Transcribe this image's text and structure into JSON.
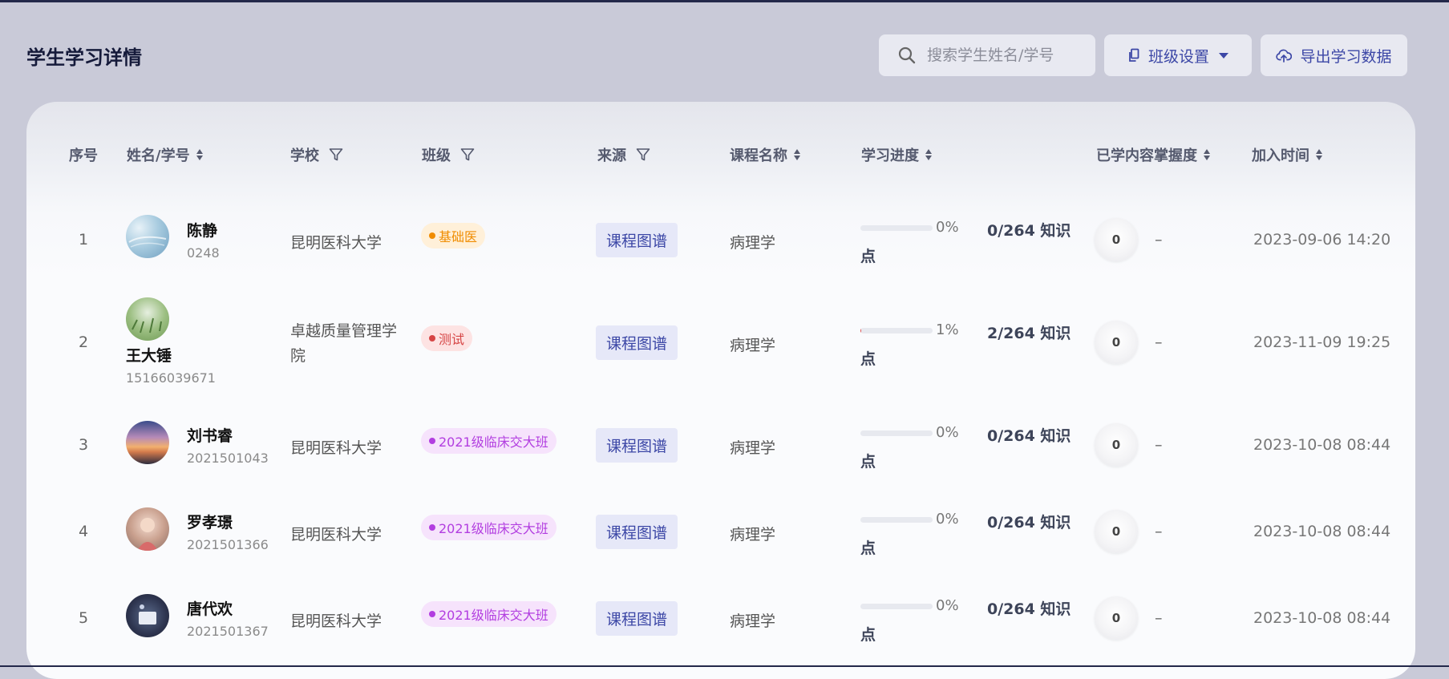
{
  "page": {
    "title": "学生学习详情"
  },
  "toolbar": {
    "search_placeholder": "搜索学生姓名/学号",
    "class_settings_label": "班级设置",
    "export_label": "导出学习数据"
  },
  "table": {
    "headers": {
      "index": "序号",
      "name": "姓名/学号",
      "school": "学校",
      "class": "班级",
      "source": "来源",
      "course": "课程名称",
      "progress": "学习进度",
      "mastery": "已学内容掌握度",
      "joined": "加入时间"
    },
    "rows": [
      {
        "index": "1",
        "name": "陈静",
        "student_id": "0248",
        "school": "昆明医科大学",
        "class_tag": "基础医",
        "source": "课程图谱",
        "course": "病理学",
        "progress_pct": "0%",
        "progress_value": 0,
        "knowledge_a": "0/264 知识",
        "knowledge_b": "点",
        "mastery": "0",
        "mastery_text": "–",
        "joined": "2023-09-06 14:20"
      },
      {
        "index": "2",
        "name": "王大锤",
        "student_id": "15166039671",
        "school": "卓越质量管理学院",
        "class_tag": "测试",
        "source": "课程图谱",
        "course": "病理学",
        "progress_pct": "1%",
        "progress_value": 1,
        "knowledge_a": "2/264 知识",
        "knowledge_b": "点",
        "mastery": "0",
        "mastery_text": "–",
        "joined": "2023-11-09 19:25"
      },
      {
        "index": "3",
        "name": "刘书睿",
        "student_id": "2021501043",
        "school": "昆明医科大学",
        "class_tag": "2021级临床交大班",
        "source": "课程图谱",
        "course": "病理学",
        "progress_pct": "0%",
        "progress_value": 0,
        "knowledge_a": "0/264 知识",
        "knowledge_b": "点",
        "mastery": "0",
        "mastery_text": "–",
        "joined": "2023-10-08 08:44"
      },
      {
        "index": "4",
        "name": "罗孝璟",
        "student_id": "2021501366",
        "school": "昆明医科大学",
        "class_tag": "2021级临床交大班",
        "source": "课程图谱",
        "course": "病理学",
        "progress_pct": "0%",
        "progress_value": 0,
        "knowledge_a": "0/264 知识",
        "knowledge_b": "点",
        "mastery": "0",
        "mastery_text": "–",
        "joined": "2023-10-08 08:44"
      },
      {
        "index": "5",
        "name": "唐代欢",
        "student_id": "2021501367",
        "school": "昆明医科大学",
        "class_tag": "2021级临床交大班",
        "source": "课程图谱",
        "course": "病理学",
        "progress_pct": "0%",
        "progress_value": 0,
        "knowledge_a": "0/264 知识",
        "knowledge_b": "点",
        "mastery": "0",
        "mastery_text": "–",
        "joined": "2023-10-08 08:44"
      }
    ]
  },
  "colors": {
    "accent": "#3c47a6",
    "tag_orange": "#f08c00",
    "tag_orange_bg": "#fff0d9",
    "tag_red": "#d64545",
    "tag_red_bg": "#fde3e3",
    "tag_purple": "#b23ee0",
    "tag_purple_bg": "#f6e3fc",
    "progress_fill": "#e04848"
  }
}
